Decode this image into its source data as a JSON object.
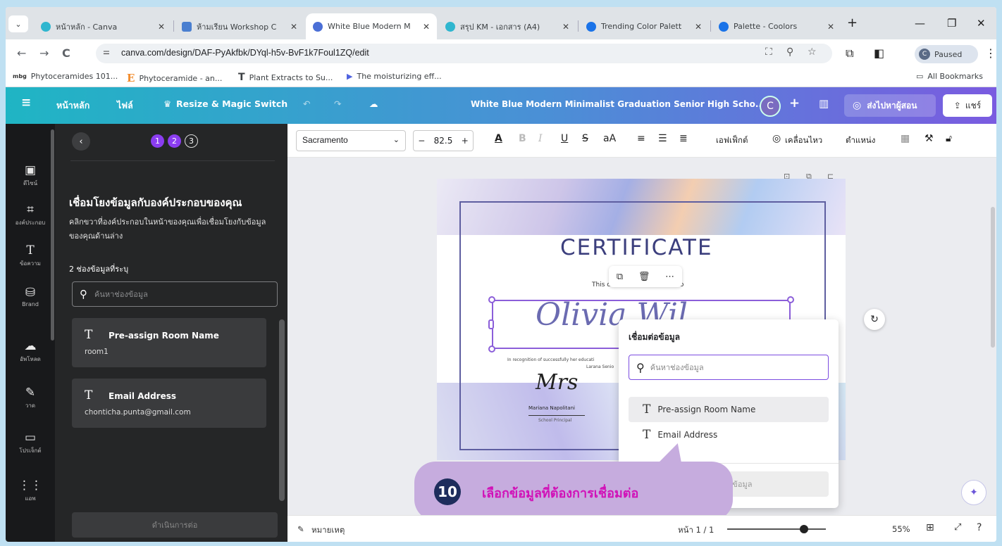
{
  "browser": {
    "tabs": [
      {
        "title": "หน้าหลัก - Canva",
        "favicon_color": "#2fb6cf"
      },
      {
        "title": "ห้ามเรียน Workshop C",
        "favicon_color": "#4a7fd0"
      },
      {
        "title": "White Blue Modern M",
        "favicon_color": "#4b6fd6"
      },
      {
        "title": "สรุป KM - เอกสาร (A4)",
        "favicon_color": "#2fb6cf"
      },
      {
        "title": "Trending Color Palett",
        "favicon_color": "#1a73e8"
      },
      {
        "title": "Palette - Coolors",
        "favicon_color": "#1a73e8"
      }
    ],
    "url": "canva.com/design/DAF-PyAkfbk/DYql-h5v-BvF1k7Foul1ZQ/edit",
    "profile_label": "Paused",
    "profile_initial": "C",
    "bookmarks": [
      {
        "icon": "mbg",
        "label": "Phytoceramides 101..."
      },
      {
        "icon": "E",
        "label": "Phytoceramide - an..."
      },
      {
        "icon": "T",
        "label": "Plant Extracts to Su..."
      },
      {
        "icon": "▶",
        "label": "The moisturizing eff..."
      }
    ],
    "all_bookmarks": "All Bookmarks"
  },
  "canva_header": {
    "home": "หน้าหลัก",
    "file": "ไฟล์",
    "resize": "Resize & Magic Switch",
    "doc_title": "White Blue Modern Minimalist Graduation Senior High Scho...",
    "avatar_initial": "C",
    "present": "ส่งไปหาผู้สอน",
    "share": "แชร์"
  },
  "rail": [
    {
      "icon": "▣",
      "label": "ดีไซน์"
    },
    {
      "icon": "⌗",
      "label": "องค์ประกอบ"
    },
    {
      "icon": "T",
      "label": "ข้อความ"
    },
    {
      "icon": "⛁",
      "label": "Brand"
    },
    {
      "icon": "☁",
      "label": "อัพโหลด"
    },
    {
      "icon": "✎",
      "label": "วาด"
    },
    {
      "icon": "▭",
      "label": "โปรเจ็กต์"
    },
    {
      "icon": "⋮⋮",
      "label": "แอพ"
    }
  ],
  "panel": {
    "steps": [
      "1",
      "2",
      "3"
    ],
    "heading": "เชื่อมโยงข้อมูลกับองค์ประกอบของคุณ",
    "subtext": "คลิกขวาที่องค์ประกอบในหน้าของคุณเพื่อเชื่อมโยงกับข้อมูลของคุณด้านล่าง",
    "field_count": "2 ช่องข้อมูลที่ระบุ",
    "search_placeholder": "ค้นหาช่องข้อมูล",
    "fields": [
      {
        "name": "Pre-assign Room Name",
        "value": "room1"
      },
      {
        "name": "Email Address",
        "value": "chonticha.punta@gmail.com"
      }
    ],
    "continue": "ดำเนินการต่อ"
  },
  "toolbar": {
    "font": "Sacramento",
    "size": "82.5",
    "effects": "เอฟเฟ็กต์",
    "animate": "เคลื่อนไหว",
    "position": "ตำแหน่ง"
  },
  "certificate": {
    "title": "CERTIFICATE",
    "awarded": "This certificate is awarded to",
    "name": "Olivia  Wil",
    "recognition": "In recognition of successfully her educati",
    "recognition2": "Larana Senio",
    "signer": "Mariana Napolitani",
    "signer_role": "School Principal",
    "signature": "Mrs"
  },
  "connect_popup": {
    "title": "เชื่อมต่อข้อมูล",
    "search_placeholder": "ค้นหาช่องข้อมูล",
    "items": [
      "Pre-assign Room Name",
      "Email Address"
    ],
    "button": "เชื่อมต่อข้อมูล"
  },
  "callout": {
    "number": "10",
    "text": "เลือกข้อมูลที่ต้องการเชื่อมต่อ"
  },
  "statusbar": {
    "notes": "หมายเหตุ",
    "page": "หน้า 1 / 1",
    "zoom": "55%",
    "zoom_fraction": 0.78
  }
}
